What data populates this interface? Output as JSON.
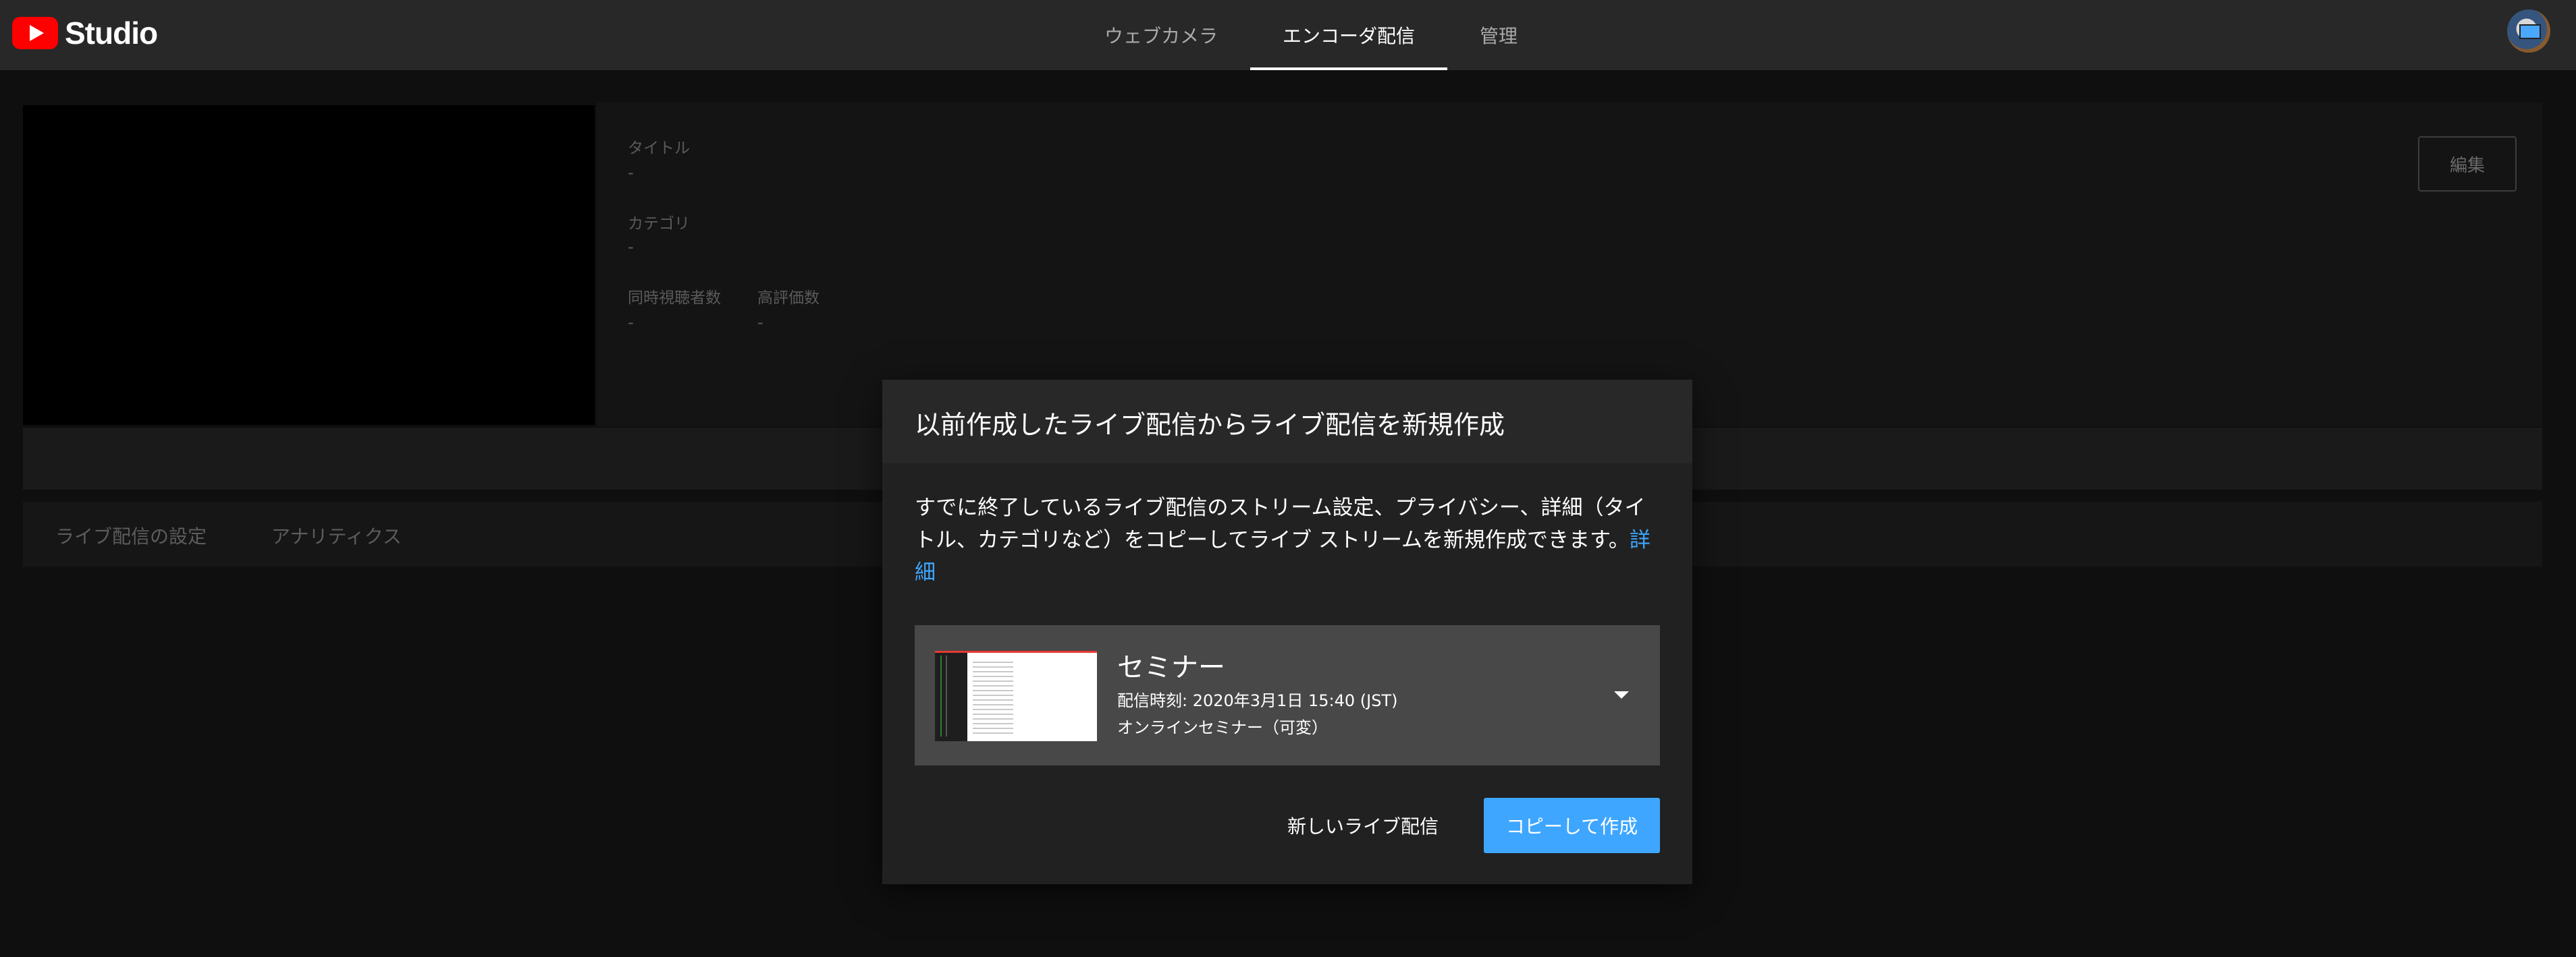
{
  "header": {
    "logo_text": "Studio",
    "tabs": [
      {
        "label": "ウェブカメラ"
      },
      {
        "label": "エンコーダ配信"
      },
      {
        "label": "管理"
      }
    ],
    "active_tab": "エンコーダ配信"
  },
  "details": {
    "title_label": "タイトル",
    "title_value": "-",
    "category_label": "カテゴリ",
    "category_value": "-",
    "viewers_label": "同時視聴者数",
    "viewers_value": "-",
    "likes_label": "高評価数",
    "likes_value": "-",
    "edit_button": "編集"
  },
  "lower_tabs": [
    {
      "label": "ライブ配信の設定"
    },
    {
      "label": "アナリティクス"
    }
  ],
  "modal": {
    "title": "以前作成したライブ配信からライブ配信を新規作成",
    "description": "すでに終了しているライブ配信のストリーム設定、プライバシー、詳細（タイトル、カテゴリなど）をコピーしてライブ ストリームを新規作成できます。",
    "learn_more_link": "詳細",
    "stream": {
      "title": "セミナー",
      "scheduled": "配信時刻: 2020年3月1日 15:40 (JST)",
      "description": "オンラインセミナー（可変）"
    },
    "new_stream_button": "新しいライブ配信",
    "copy_create_button": "コピーして作成"
  },
  "colors": {
    "accent": "#3ea6ff",
    "brand_red": "#ff0000",
    "topbar": "#282828",
    "modal_bg": "#212121"
  },
  "icons": {
    "logo": "youtube-play-icon",
    "dropdown": "chevron-down-icon",
    "account": "avatar"
  }
}
